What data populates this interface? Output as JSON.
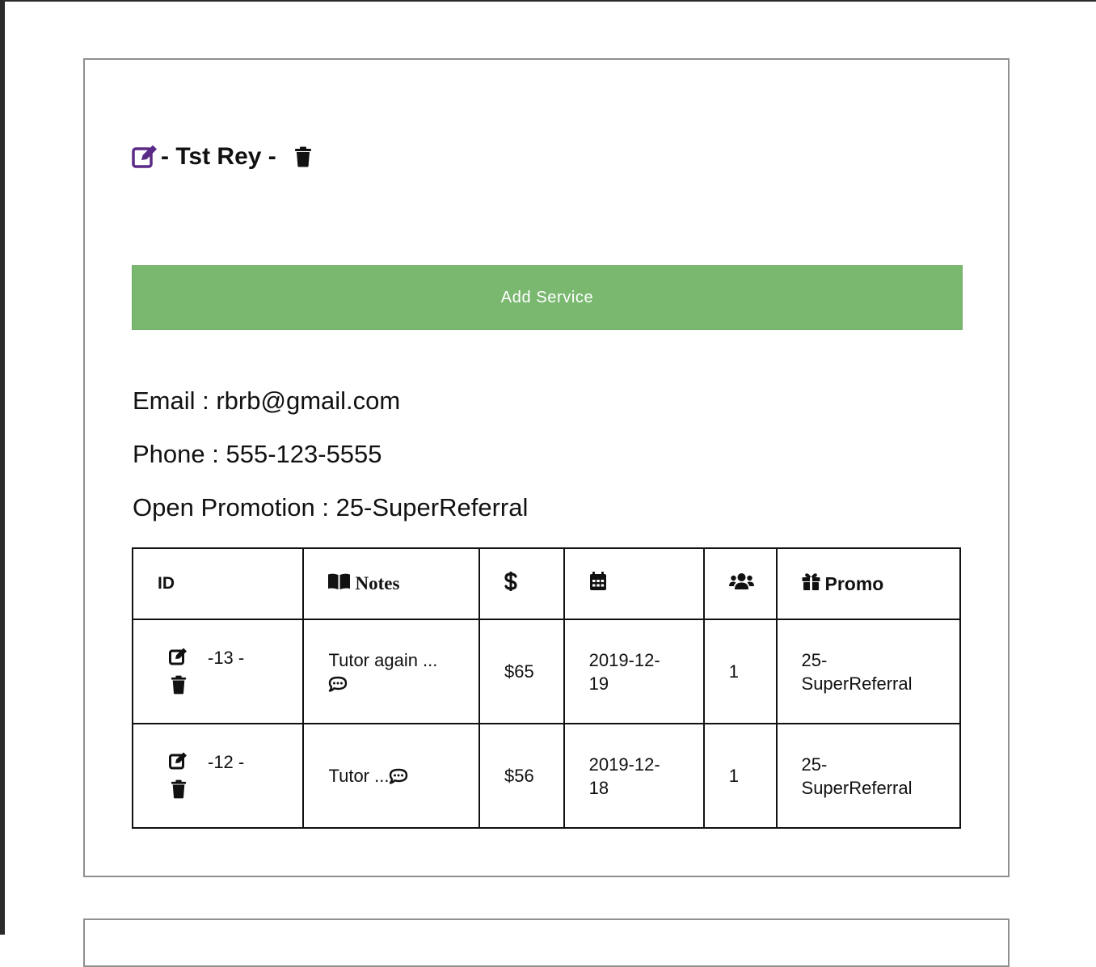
{
  "customer": {
    "name": "- Tst Rey -",
    "email_label": "Email : rbrb@gmail.com",
    "phone_label": "Phone : 555-123-5555",
    "promotion_label": "Open Promotion : 25-SuperReferral"
  },
  "actions": {
    "add_service_label": "Add Service"
  },
  "colors": {
    "accent_purple": "#5b2a86",
    "add_button_green": "#7ab870"
  },
  "table": {
    "headers": {
      "id": "ID",
      "notes": "Notes",
      "price_icon": "dollar-icon",
      "date_icon": "calendar-icon",
      "people_icon": "users-icon",
      "promo": "Promo"
    },
    "rows": [
      {
        "id": "-13 -",
        "notes_line1": "Tutor again ...",
        "notes_line2": "",
        "price": "$65",
        "date_line1": "2019-12-",
        "date_line2": "19",
        "count": "1",
        "promo_line1": "25-",
        "promo_line2": "SuperReferral"
      },
      {
        "id": "-12 -",
        "notes_line1": "Tutor ...",
        "notes_line2": "",
        "price": "$56",
        "date_line1": "2019-12-",
        "date_line2": "18",
        "count": "1",
        "promo_line1": "25-",
        "promo_line2": "SuperReferral"
      }
    ]
  }
}
